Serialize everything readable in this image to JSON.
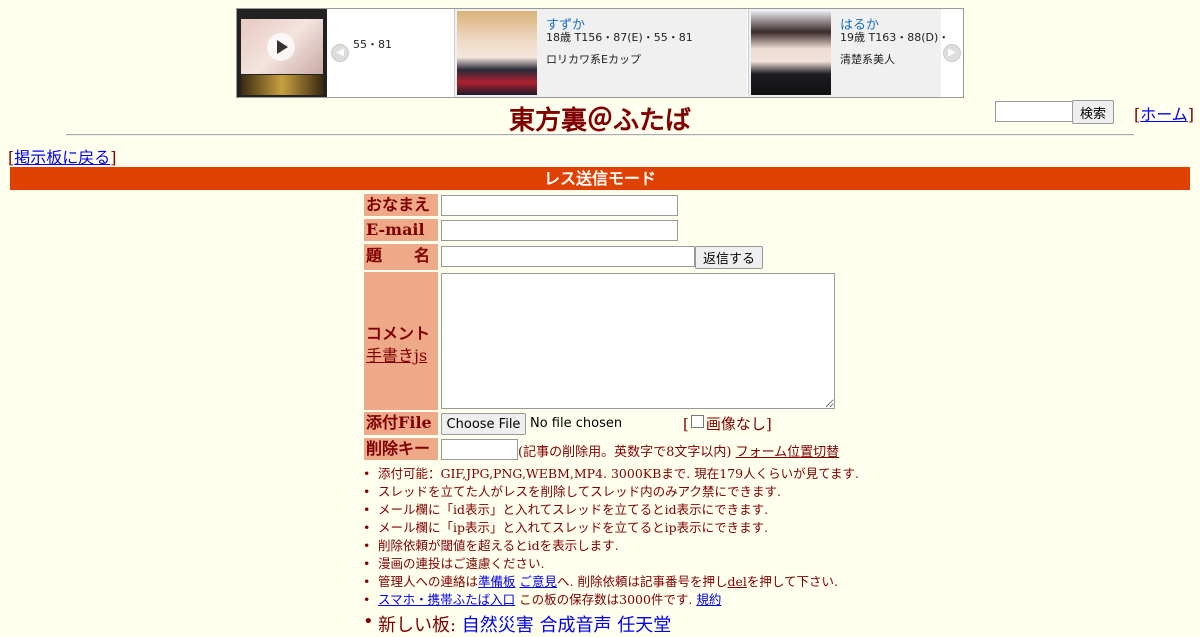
{
  "ad": {
    "partial_meta": "55・81",
    "items": [
      {
        "name": "すずか",
        "meta": "18歳 T156・87(E)・55・81",
        "desc": "ロリカワ系Eカップ"
      },
      {
        "name": "はるか",
        "meta": "19歳 T163・88(D)・",
        "desc": "清楚系美人"
      }
    ]
  },
  "header": {
    "title": "東方裏＠ふたば",
    "search_button": "検索",
    "home_prefix": "[",
    "home_link": "ホーム",
    "home_suffix": "]"
  },
  "nav": {
    "back_prefix": "[",
    "back_link": "掲示板に戻る",
    "back_suffix": "]"
  },
  "mode_label": "レス送信モード",
  "form": {
    "name_label": "おなまえ",
    "email_label": "E-mail",
    "subject_label": "題　　名",
    "submit_button": "返信する",
    "comment_label": "コメント",
    "handwrite_link": "手書きjs",
    "file_label": "添付File",
    "file_button": "Choose File",
    "file_status": "No file chosen",
    "noimage_prefix": "[",
    "noimage_label": "画像なし]",
    "delkey_label": "削除キー",
    "delkey_note": "(記事の削除用。英数字で8文字以内)",
    "form_toggle_link": "フォーム位置切替"
  },
  "notes": [
    {
      "text": "添付可能：GIF,JPG,PNG,WEBM,MP4. 3000KBまで. 現在179人くらいが見てます."
    },
    {
      "text": "スレッドを立てた人がレスを削除してスレッド内のみアク禁にできます."
    },
    {
      "text": "メール欄に「id表示」と入れてスレッドを立てるとid表示にできます."
    },
    {
      "text": "メール欄に「ip表示」と入れてスレッドを立てるとip表示にできます."
    },
    {
      "text": "削除依頼が閾値を超えるとidを表示します."
    },
    {
      "text": "漫画の連投はご遠慮ください."
    }
  ],
  "admin_note": {
    "prefix": "管理人への連絡は",
    "link1": "準備板",
    "link2": "ご意見",
    "middle": "へ. 削除依頼は記事番号を押し",
    "del_link": "del",
    "suffix": "を押して下さい."
  },
  "mobile_note": {
    "link": "スマホ・携帯ふたば入口",
    "text": " この板の保存数は3000件です. ",
    "rules_link": "規約"
  },
  "new_boards": {
    "label": "新しい板: ",
    "boards": [
      "自然災害",
      "合成音声",
      "任天堂"
    ]
  }
}
